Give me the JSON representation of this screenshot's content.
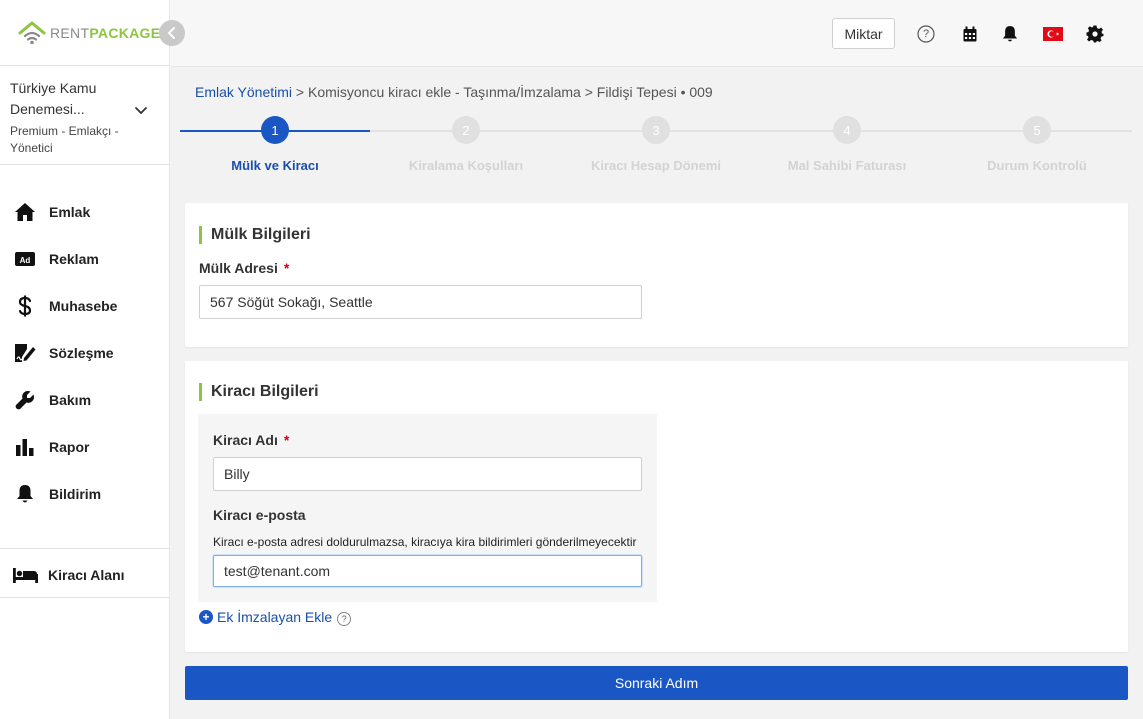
{
  "logo": {
    "part1": "RENT",
    "part2": "PACKAGE"
  },
  "company": {
    "name": "Türkiye Kamu Denemesi...",
    "role": "Premium - Emlakçı - Yönetici"
  },
  "sidebar": {
    "items": [
      {
        "label": "Emlak",
        "icon": "home-icon"
      },
      {
        "label": "Reklam",
        "icon": "ad-icon"
      },
      {
        "label": "Muhasebe",
        "icon": "dollar-icon"
      },
      {
        "label": "Sözleşme",
        "icon": "contract-icon"
      },
      {
        "label": "Bakım",
        "icon": "wrench-icon"
      },
      {
        "label": "Rapor",
        "icon": "bar-chart-icon"
      },
      {
        "label": "Bildirim",
        "icon": "bell-icon"
      }
    ],
    "tenant_area": {
      "label": "Kiracı Alanı",
      "icon": "bed-icon"
    }
  },
  "topbar": {
    "miktar_label": "Miktar",
    "help_glyph": "?"
  },
  "breadcrumb": {
    "root": "Emlak Yönetimi",
    "sep": ">",
    "level2": "Komisyoncu kiracı ekle - Taşınma/İmzalama",
    "level3": "Fildişi Tepesi • 009"
  },
  "stepper": {
    "steps": [
      {
        "num": "1",
        "label": "Mülk ve Kiracı",
        "active": true
      },
      {
        "num": "2",
        "label": "Kiralama Koşulları",
        "active": false
      },
      {
        "num": "3",
        "label": "Kiracı Hesap Dönemi",
        "active": false
      },
      {
        "num": "4",
        "label": "Mal Sahibi Faturası",
        "active": false
      },
      {
        "num": "5",
        "label": "Durum Kontrolü",
        "active": false
      }
    ]
  },
  "property": {
    "title": "Mülk Bilgileri",
    "address_label": "Mülk Adresi",
    "required_mark": "*",
    "address_value": "567 Söğüt Sokağı, Seattle"
  },
  "tenant": {
    "title": "Kiracı Bilgileri",
    "name_label": "Kiracı Adı",
    "required_mark": "*",
    "name_value": "Billy",
    "email_label": "Kiracı e-posta",
    "email_hint": "Kiracı e-posta adresi doldurulmazsa, kiracıya kira bildirimleri gönderilmeyecektir",
    "email_value": "test@tenant.com",
    "add_signer_label": "Ek İmzalayan Ekle",
    "add_signer_plus": "+",
    "help_glyph": "?"
  },
  "next_button": {
    "label": "Sonraki Adım"
  },
  "colors": {
    "primary": "#1a56c4",
    "accent_green": "#8cc63f",
    "link": "#1a4fa8"
  }
}
